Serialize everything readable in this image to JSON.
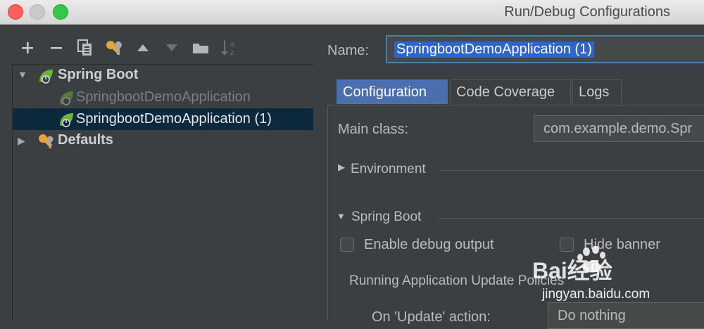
{
  "window": {
    "title": "Run/Debug Configurations"
  },
  "toolbar": {
    "add_icon": "plus-icon",
    "remove_icon": "minus-icon",
    "copy_icon": "copy-icon",
    "edit_defaults_icon": "wrench-icon",
    "move_up_icon": "arrow-up-icon",
    "move_down_icon": "arrow-down-icon",
    "folder_icon": "folder-icon",
    "sort_icon": "sort-az-icon"
  },
  "tree": {
    "group_label": "Spring Boot",
    "items": [
      {
        "label": "SpringbootDemoApplication"
      },
      {
        "label": "SpringbootDemoApplication (1)"
      }
    ],
    "defaults_label": "Defaults"
  },
  "form": {
    "name_label": "Name:",
    "name_value": "SpringbootDemoApplication (1)",
    "tabs": [
      "Configuration",
      "Code Coverage",
      "Logs"
    ],
    "main_class_label": "Main class:",
    "main_class_value": "com.example.demo.Spr",
    "environment_label": "Environment",
    "spring_boot_label": "Spring Boot",
    "enable_debug_label": "Enable debug output",
    "hide_banner_label": "Hide banner",
    "update_policies_label": "Running Application Update Policies",
    "update_action_label": "On 'Update' action:",
    "update_action_value": "Do nothing"
  },
  "watermark": {
    "text": "Bai经验",
    "url": "jingyan.baidu.com"
  },
  "colors": {
    "selection": "#0d293e",
    "active_tab": "#4b6eaf",
    "name_highlight": "#2f65ca"
  }
}
